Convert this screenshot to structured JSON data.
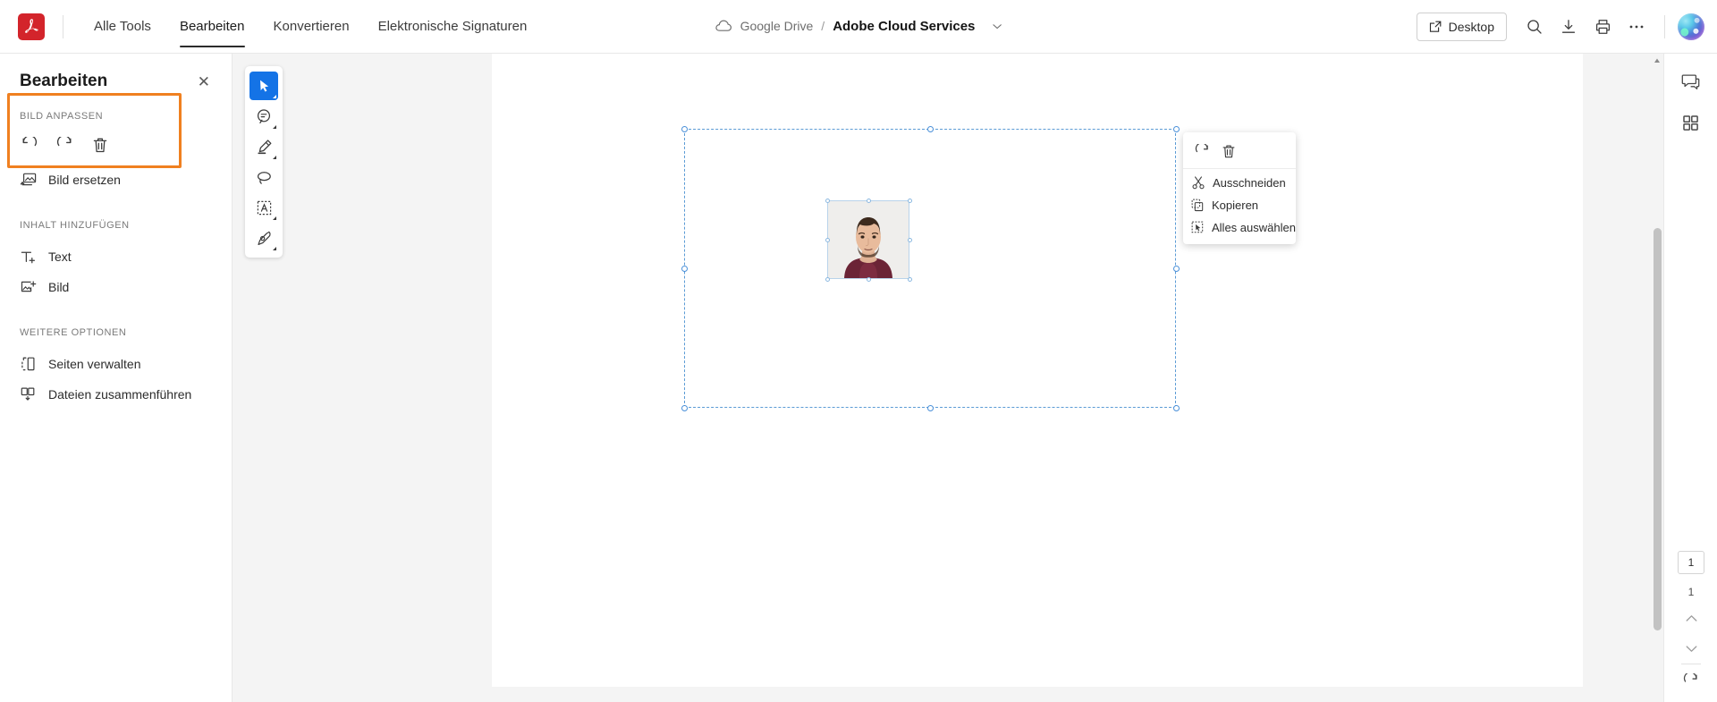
{
  "app": {
    "logo_icon": "acrobat-logo-icon",
    "nav_tabs": [
      {
        "label": "Alle Tools",
        "active": false
      },
      {
        "label": "Bearbeiten",
        "active": true
      },
      {
        "label": "Konvertieren",
        "active": false
      },
      {
        "label": "Elektronische Signaturen",
        "active": false
      }
    ]
  },
  "breadcrumb": {
    "cloud_icon": "cloud-icon",
    "storage": "Google Drive",
    "separator": "/",
    "document": "Adobe Cloud Services",
    "caret_icon": "chevron-down-icon"
  },
  "top_right": {
    "desktop_label": "Desktop",
    "desktop_icon": "external-link-icon",
    "icons": [
      {
        "name": "search-icon"
      },
      {
        "name": "download-icon"
      },
      {
        "name": "print-icon"
      },
      {
        "name": "more-options-icon"
      }
    ],
    "avatar": "user-avatar"
  },
  "left_panel": {
    "title": "Bearbeiten",
    "close_icon": "close-icon",
    "highlight_color": "#f08020",
    "sections": [
      {
        "label": "BILD ANPASSEN",
        "rotate_buttons": [
          {
            "name": "rotate-counterclockwise-icon"
          },
          {
            "name": "rotate-clockwise-icon"
          },
          {
            "name": "delete-icon"
          }
        ],
        "items": [
          {
            "label": "Bild ersetzen",
            "icon": "replace-image-icon"
          }
        ]
      },
      {
        "label": "INHALT HINZUFÜGEN",
        "items": [
          {
            "label": "Text",
            "icon": "add-text-icon"
          },
          {
            "label": "Bild",
            "icon": "add-image-icon"
          }
        ]
      },
      {
        "label": "WEITERE OPTIONEN",
        "items": [
          {
            "label": "Seiten verwalten",
            "icon": "manage-pages-icon"
          },
          {
            "label": "Dateien zusammenführen",
            "icon": "merge-files-icon"
          }
        ]
      }
    ]
  },
  "tool_rail": {
    "tools": [
      {
        "name": "select-tool",
        "active": true
      },
      {
        "name": "comment-tool",
        "active": false
      },
      {
        "name": "highlight-tool",
        "active": false
      },
      {
        "name": "lasso-tool",
        "active": false
      },
      {
        "name": "text-select-tool",
        "active": false
      },
      {
        "name": "draw-tool",
        "active": false
      }
    ]
  },
  "context_menu": {
    "top_icons": [
      {
        "name": "rotate-clockwise-icon"
      },
      {
        "name": "delete-icon"
      }
    ],
    "items": [
      {
        "label": "Ausschneiden",
        "icon": "cut-icon"
      },
      {
        "label": "Kopieren",
        "icon": "copy-icon"
      },
      {
        "label": "Alles auswählen",
        "icon": "select-all-icon"
      }
    ]
  },
  "right_rail": {
    "icons": [
      {
        "name": "comment-panel-icon"
      },
      {
        "name": "all-tools-grid-icon"
      }
    ],
    "page_current": "1",
    "page_total": "1",
    "prev_icon": "chevron-up-icon",
    "next_icon": "chevron-down-icon",
    "rotate_icon": "rotate-view-icon"
  },
  "canvas": {
    "selection_color": "#5b9bd5",
    "photo_alt": "portrait-photo"
  }
}
